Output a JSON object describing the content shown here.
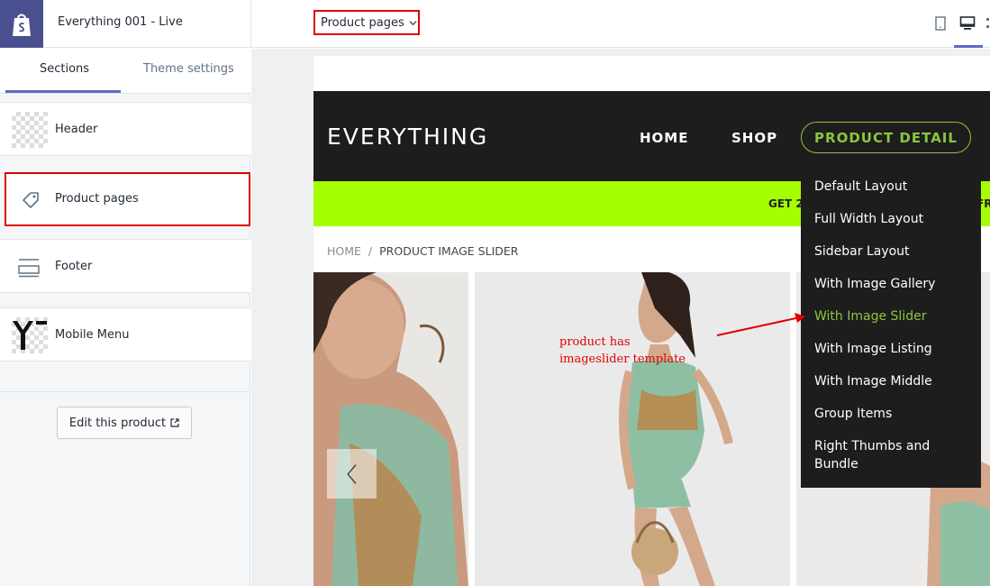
{
  "topbar": {
    "theme_name": "Everything 001 - Live",
    "page_select": "Product pages"
  },
  "sidebar": {
    "tabs": [
      {
        "label": "Sections",
        "active": true
      },
      {
        "label": "Theme settings",
        "active": false
      }
    ],
    "sections": [
      {
        "label": "Header",
        "icon": "header-thumbnail"
      },
      {
        "label": "Product pages",
        "icon": "tag-icon"
      },
      {
        "label": "Footer",
        "icon": "footer-layout-icon"
      },
      {
        "label": "Mobile Menu",
        "icon": "mobile-menu-thumbnail"
      }
    ],
    "edit_button": "Edit this product"
  },
  "store": {
    "brand": "EVERYTHING",
    "nav": {
      "home": "HOME",
      "shop": "SHOP",
      "product_detail": "PRODUCT DETAIL"
    },
    "promo_left": "GET 2",
    "promo_right": "FR",
    "breadcrumb": {
      "home": "HOME",
      "separator": "/",
      "current": "PRODUCT IMAGE SLIDER"
    },
    "dropdown": [
      {
        "label": "Default Layout",
        "active": false
      },
      {
        "label": "Full Width Layout",
        "active": false
      },
      {
        "label": "Sidebar Layout",
        "active": false
      },
      {
        "label": "With Image Gallery",
        "active": false
      },
      {
        "label": "With Image Slider",
        "active": true
      },
      {
        "label": "With Image Listing",
        "active": false
      },
      {
        "label": "With Image Middle",
        "active": false
      },
      {
        "label": "Group Items",
        "active": false
      },
      {
        "label": "Right Thumbs and Bundle",
        "active": false
      }
    ]
  },
  "annotation": {
    "line1": "product has",
    "line2": "imageslider template"
  },
  "colors": {
    "shopify_purple": "#4a4f8f",
    "accent": "#5c6ac4",
    "highlight_red": "#e00000",
    "store_dark": "#1d1d1d",
    "store_green": "#8cc63f",
    "promo_lime": "#a6ff00"
  }
}
